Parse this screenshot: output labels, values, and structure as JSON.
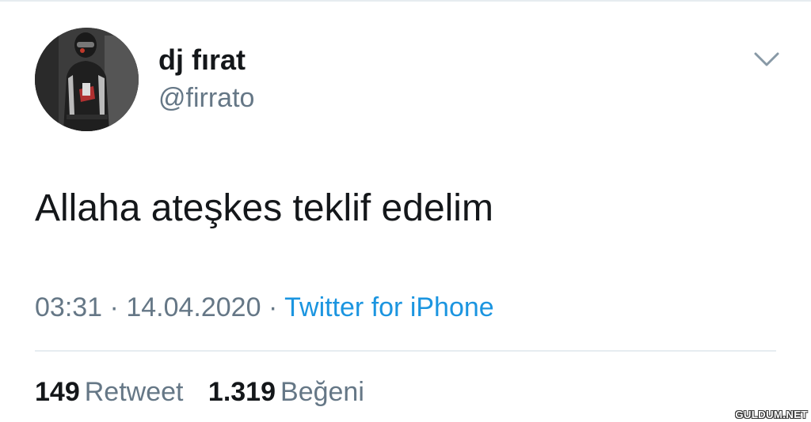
{
  "tweet": {
    "user": {
      "display_name": "dj fırat",
      "handle": "@firrato"
    },
    "text": "Allaha ateşkes teklif edelim",
    "meta": {
      "time": "03:31",
      "date": "14.04.2020",
      "separator": "·",
      "source": "Twitter for iPhone"
    },
    "stats": {
      "retweets_count": "149",
      "retweets_label": "Retweet",
      "likes_count": "1.319",
      "likes_label": "Beğeni"
    }
  },
  "watermark": "GULDUM.NET",
  "icons": {
    "menu": "chevron-down-icon"
  },
  "colors": {
    "text_primary": "#14171a",
    "text_secondary": "#657786",
    "link": "#1b95e0",
    "divider": "#e6ecf0"
  }
}
